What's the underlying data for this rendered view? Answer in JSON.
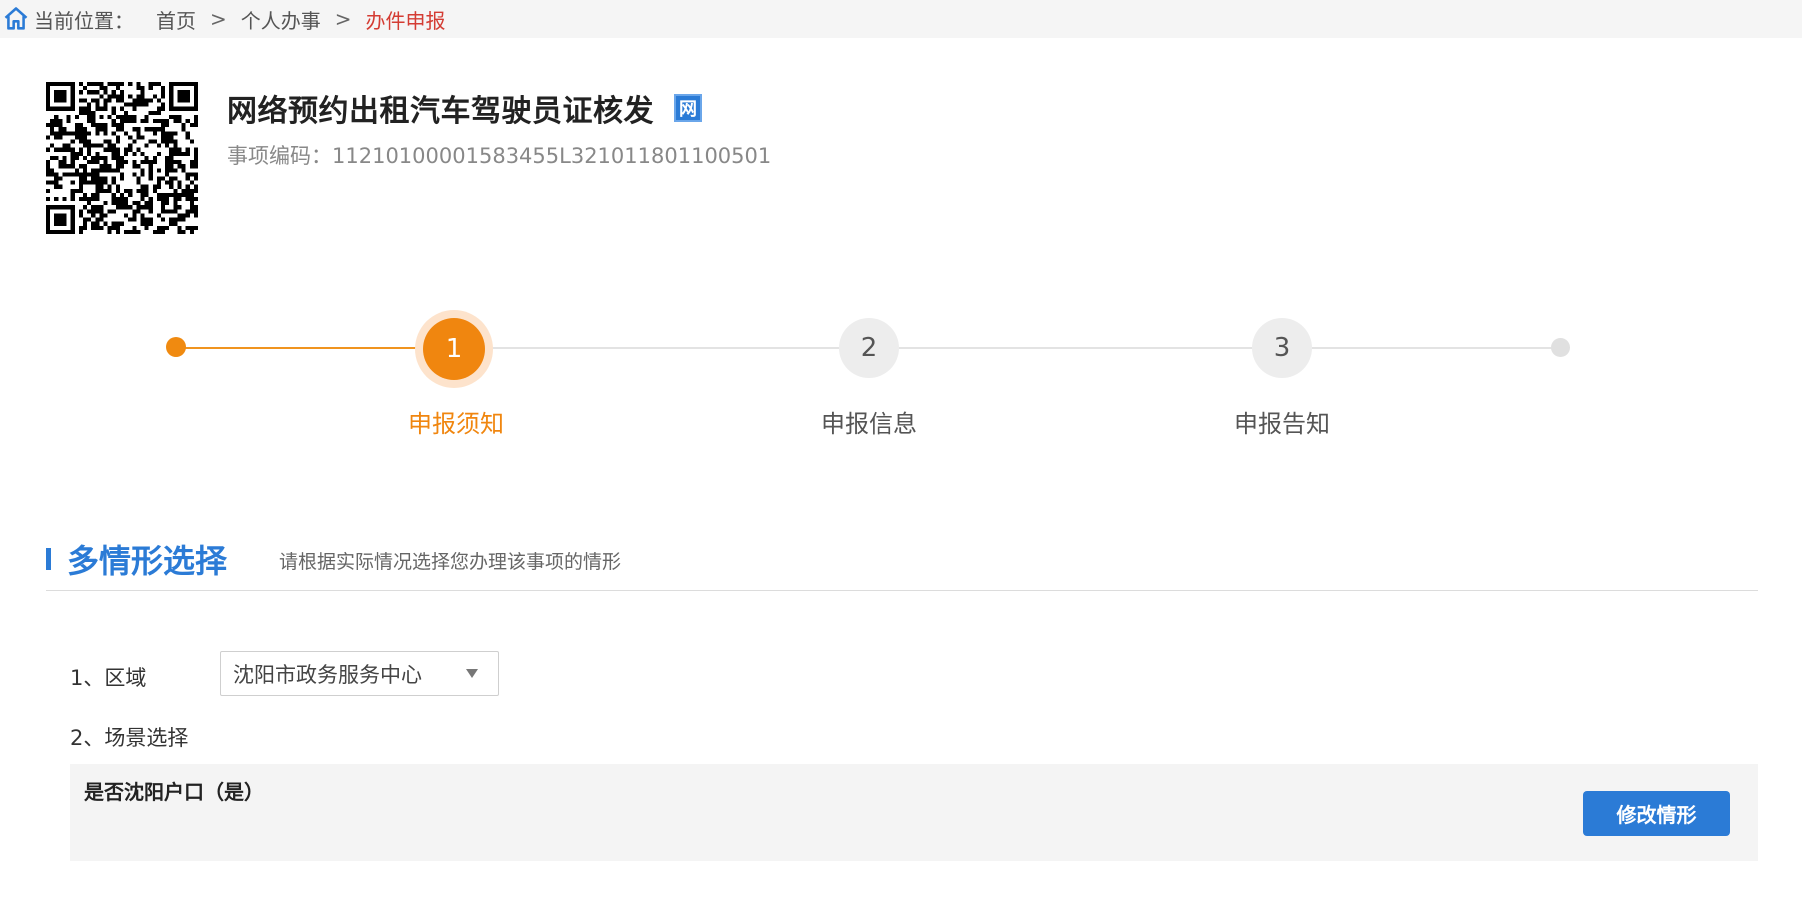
{
  "breadcrumb": {
    "label": "当前位置：",
    "items": [
      "首页",
      "个人办事",
      "办件申报"
    ],
    "separator": ">"
  },
  "header": {
    "title": "网络预约出租汽车驾驶员证核发",
    "badge": "网",
    "code_label": "事项编码：",
    "code_value": "11210100001583455L321011801100501"
  },
  "steps": [
    {
      "number": "1",
      "label": "申报须知",
      "active": true
    },
    {
      "number": "2",
      "label": "申报信息",
      "active": false
    },
    {
      "number": "3",
      "label": "申报告知",
      "active": false
    }
  ],
  "section": {
    "title": "多情形选择",
    "subtitle": "请根据实际情况选择您办理该事项的情形"
  },
  "form": {
    "region_label": "1、区域",
    "region_value": "沈阳市政务服务中心",
    "scene_label": "2、场景选择",
    "scene_text": "是否沈阳户口（是）",
    "modify_button": "修改情形"
  },
  "colors": {
    "accent_blue": "#2b7bd6",
    "accent_orange": "#f0860f",
    "breadcrumb_current": "#d43c33"
  },
  "icons": {
    "home": "home-icon",
    "qr": "qr-code-icon",
    "dropdown": "chevron-down-icon"
  }
}
